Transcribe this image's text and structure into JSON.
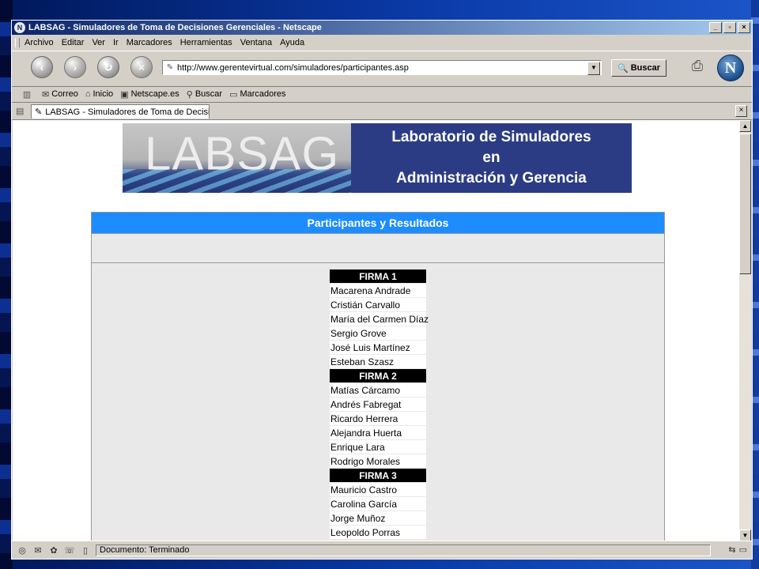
{
  "window": {
    "title": "LABSAG - Simuladores de Toma de Decisiones Gerenciales - Netscape",
    "minimize": "_",
    "maximize": "▫",
    "close": "×"
  },
  "menu": {
    "items": [
      "Archivo",
      "Editar",
      "Ver",
      "Ir",
      "Marcadores",
      "Herramientas",
      "Ventana",
      "Ayuda"
    ]
  },
  "nav": {
    "url": "http://www.gerentevirtual.com/simuladores/participantes.asp",
    "search_label": "Buscar"
  },
  "links": {
    "items": [
      {
        "label": "Correo",
        "icon": "mail-icon"
      },
      {
        "label": "Inicio",
        "icon": "home-icon"
      },
      {
        "label": "Netscape.es",
        "icon": "my-netscape-icon"
      },
      {
        "label": "Buscar",
        "icon": "search-icon"
      },
      {
        "label": "Marcadores",
        "icon": "folder-icon"
      }
    ]
  },
  "tab": {
    "title": "LABSAG - Simuladores de Toma de Decisio..."
  },
  "banner": {
    "logo": "LABSAG",
    "line1": "Laboratorio de Simuladores",
    "line2": "en",
    "line3": "Administración y Gerencia"
  },
  "panel": {
    "title": "Participantes y Resultados"
  },
  "firms": [
    {
      "name": "FIRMA 1",
      "members": [
        "Macarena Andrade",
        "Cristián Carvallo",
        "María del Carmen Díaz",
        "Sergio Grove",
        "José Luis Martínez",
        "Esteban Szasz"
      ]
    },
    {
      "name": "FIRMA 2",
      "members": [
        "Matías Cárcamo",
        "Andrés Fabregat",
        "Ricardo Herrera",
        "Alejandra Huerta",
        "Enrique Lara",
        "Rodrigo Morales"
      ]
    },
    {
      "name": "FIRMA 3",
      "members": [
        "Mauricio Castro",
        "Carolina García",
        "Jorge Muñoz",
        "Leopoldo Porras"
      ]
    }
  ],
  "status": {
    "text": "Documento: Terminado"
  },
  "colors": {
    "panel_header": "#1c8cff",
    "banner_bg": "#2c3c84",
    "firm_header": "#000000"
  }
}
